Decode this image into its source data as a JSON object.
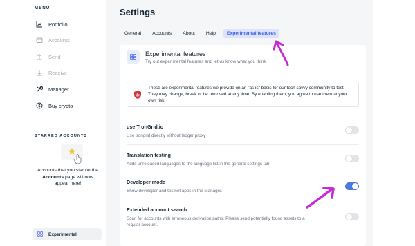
{
  "sidebar": {
    "menu_label": "MENU",
    "items": [
      {
        "label": "Portfolio",
        "icon": "chart-line-icon",
        "disabled": false
      },
      {
        "label": "Accounts",
        "icon": "wallet-icon",
        "disabled": true
      },
      {
        "label": "Send",
        "icon": "arrow-up-icon",
        "disabled": true
      },
      {
        "label": "Receive",
        "icon": "arrow-down-icon",
        "disabled": true
      },
      {
        "label": "Manager",
        "icon": "tools-icon",
        "disabled": false
      },
      {
        "label": "Buy crypto",
        "icon": "dollar-coin-icon",
        "disabled": false
      }
    ],
    "starred_label": "STARRED ACCOUNTS",
    "starred_text_before": "Accounts that you star on the",
    "starred_text_bold": "Accounts",
    "starred_text_after": "page will now appear here!",
    "bottom_item": "Experimental"
  },
  "main": {
    "title": "Settings",
    "tabs": [
      {
        "label": "General",
        "active": false
      },
      {
        "label": "Accounts",
        "active": false
      },
      {
        "label": "About",
        "active": false
      },
      {
        "label": "Help",
        "active": false
      },
      {
        "label": "Experimental features",
        "active": true
      }
    ],
    "card": {
      "title": "Experimental features",
      "subtitle": "Try out experimental features and let us know what you think",
      "warning": "These are experimental features we provide on an \"as is\" basis for our tech savvy community to test. They may change, break or be removed at any time. By enabling them, you agree to use them at your own risk.",
      "settings": [
        {
          "title": "use TronGrid.io",
          "desc": "Use trongrid directly without ledger proxy",
          "enabled": false
        },
        {
          "title": "Translation testing",
          "desc": "Adds unreleased languages to the language list in the general settings tab.",
          "enabled": false
        },
        {
          "title": "Developer mode",
          "desc": "Show developer and testnet apps in the Manager.",
          "enabled": true
        },
        {
          "title": "Extended account search",
          "desc": "Scan for accounts with erroneous derivation paths. Please send potentially found assets to a regular account.",
          "enabled": false
        }
      ]
    }
  },
  "colors": {
    "accent": "#4063e8",
    "toggle_on": "#4f78de",
    "annotation_arrow": "#c72bd6",
    "warning_red": "#d5343f"
  }
}
